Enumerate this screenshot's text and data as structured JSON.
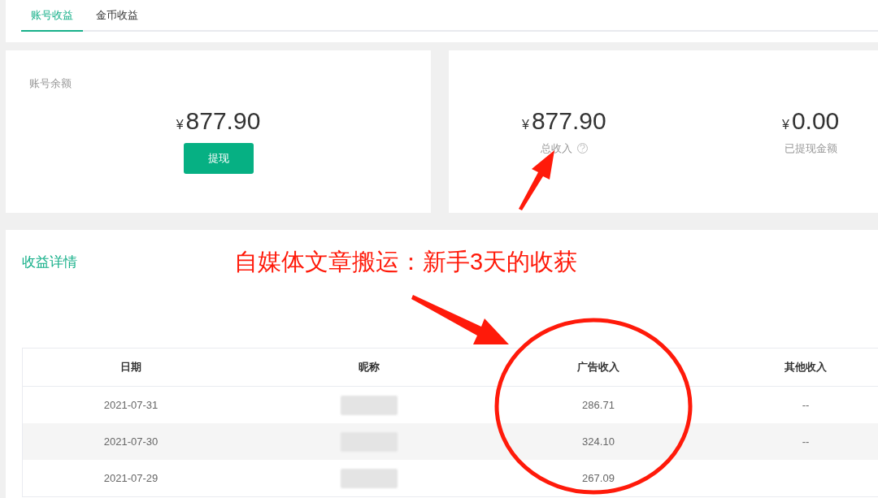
{
  "tabs": [
    {
      "label": "账号收益",
      "selected": true
    },
    {
      "label": "金币收益",
      "selected": false
    }
  ],
  "balance_card": {
    "label": "账号余额",
    "currency": "¥",
    "amount": "877.90",
    "button": "提现"
  },
  "summary_card": {
    "items": [
      {
        "currency": "¥",
        "amount": "877.90",
        "label": "总收入",
        "help": true
      },
      {
        "currency": "¥",
        "amount": "0.00",
        "label": "已提现金额",
        "help": false
      }
    ]
  },
  "details": {
    "title": "收益详情",
    "table": {
      "columns": [
        "日期",
        "昵称",
        "广告收入",
        "其他收入"
      ],
      "rows": [
        {
          "date": "2021-07-31",
          "nickname": {
            "kind": "blurred"
          },
          "ad_income": "286.71",
          "other_income": "--"
        },
        {
          "date": "2021-07-30",
          "nickname": {
            "kind": "blurred"
          },
          "ad_income": "324.10",
          "other_income": "--"
        },
        {
          "date": "2021-07-29",
          "nickname": {
            "kind": "blurred"
          },
          "ad_income": "267.09"
        }
      ]
    }
  },
  "annotation": {
    "headline": "自媒体文章搬运：新手3天的收获"
  }
}
